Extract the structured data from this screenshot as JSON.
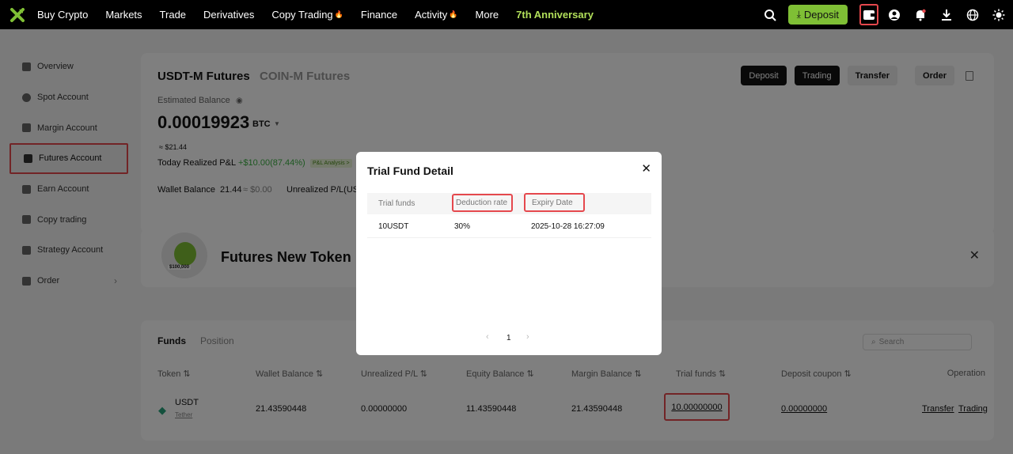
{
  "nav": {
    "items": [
      "Buy Crypto",
      "Markets",
      "Trade",
      "Derivatives",
      "Copy Trading",
      "Finance",
      "Activity",
      "More"
    ],
    "anniversary": "7th Anniversary",
    "deposit_label": "Deposit",
    "icons": [
      "search-icon",
      "wallet-icon",
      "user-icon",
      "bell-icon",
      "download-icon",
      "globe-icon",
      "theme-icon"
    ]
  },
  "sidebar": {
    "items": [
      "Overview",
      "Spot Account",
      "Margin Account",
      "Futures Account",
      "Earn Account",
      "Copy trading",
      "Strategy Account",
      "Order"
    ],
    "active": "Futures Account"
  },
  "account": {
    "tab_usdt": "USDT-M Futures",
    "tab_coin": "COIN-M Futures",
    "buttons": {
      "deposit": "Deposit",
      "trading": "Trading",
      "transfer": "Transfer",
      "order": "Order"
    },
    "estimated_label": "Estimated Balance",
    "balance": "0.00019923",
    "balance_unit": "BTC",
    "usd_approx": "≈ $21.44",
    "realized_label": "Today Realized P&L",
    "realized_value": "+$10.00(87.44%)",
    "pnl_link": "P&L Analysis >",
    "wallet_balance_label": "Wallet Balance",
    "wallet_balance_value": "21.44",
    "wallet_balance_usd": "≈ $0.00",
    "unrealized_label": "Unrealized P/L(US"
  },
  "banner": {
    "title": "Futures New Token",
    "prize": "$100,000"
  },
  "funds": {
    "tabs": [
      "Funds",
      "Position"
    ],
    "search_placeholder": "Search",
    "columns": [
      "Token",
      "Wallet Balance",
      "Unrealized P/L",
      "Equity Balance",
      "Margin Balance",
      "Trial funds",
      "Deposit coupon",
      "Operation"
    ],
    "row": {
      "token": "USDT",
      "token_sub": "Tether",
      "wallet_balance": "21.43590448",
      "unrealized": "0.00000000",
      "equity": "11.43590448",
      "margin": "21.43590448",
      "trial": "10.00000000",
      "coupon": "0.00000000",
      "op_transfer": "Transfer",
      "op_trading": "Trading"
    }
  },
  "modal": {
    "title": "Trial Fund Detail",
    "columns": [
      "Trial funds",
      "Deduction rate",
      "Expiry Date"
    ],
    "rows": [
      {
        "funds": "10USDT",
        "rate": "30%",
        "expiry": "2025-10-28 16:27:09"
      }
    ],
    "page": "1"
  },
  "colors": {
    "accent": "#7fbf35",
    "highlight": "#e5484d",
    "positive": "#3cb043"
  }
}
